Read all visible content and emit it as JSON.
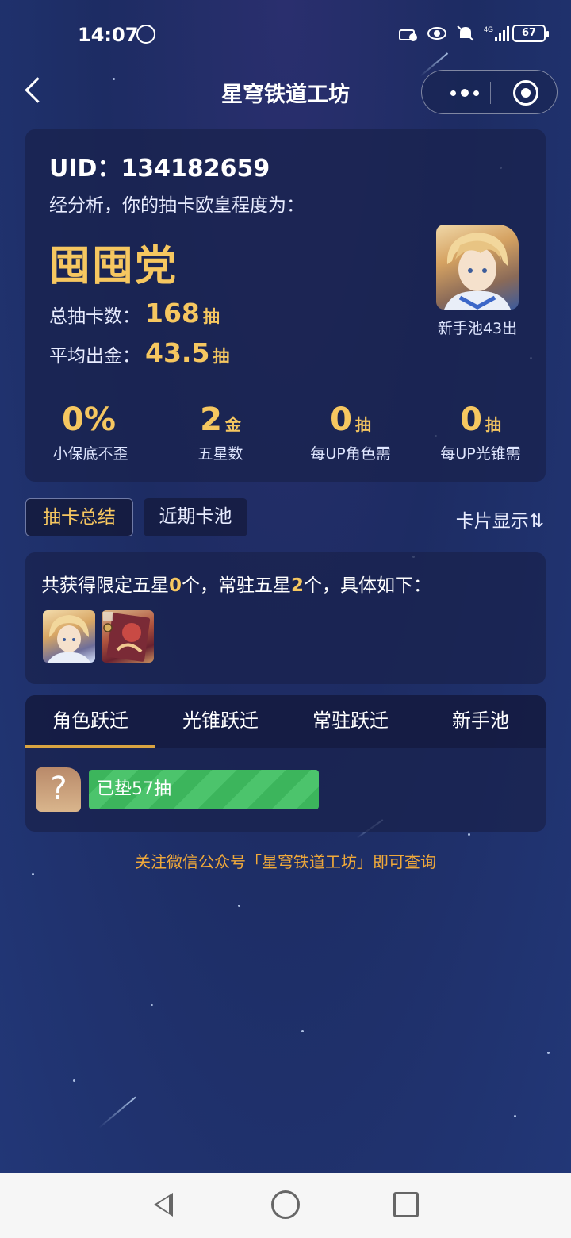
{
  "status_bar": {
    "time": "14:07",
    "battery": "67",
    "network": "4G"
  },
  "nav": {
    "title": "星穹铁道工坊"
  },
  "summary": {
    "uid_label": "UID：",
    "uid_value": "134182659",
    "analysis": "经分析，你的抽卡欧皇程度为：",
    "rank": "囤囤党",
    "total_label": "总抽卡数：",
    "total_value": "168",
    "total_unit": "抽",
    "avg_label": "平均出金：",
    "avg_value": "43.5",
    "avg_unit": "抽",
    "avatar_caption": "新手池43出",
    "stats": [
      {
        "value": "0%",
        "unit": "",
        "label": "小保底不歪"
      },
      {
        "value": "2",
        "unit": "金",
        "label": "五星数"
      },
      {
        "value": "0",
        "unit": "抽",
        "label": "每UP角色需"
      },
      {
        "value": "0",
        "unit": "抽",
        "label": "每UP光锥需"
      }
    ]
  },
  "view_tabs": {
    "summary": "抽卡总结",
    "recent": "近期卡池",
    "display_toggle": "卡片显示⇅"
  },
  "five_star": {
    "prefix": "共获得限定五星",
    "limited_count": "0",
    "middle": "个，常驻五星",
    "standard_count": "2",
    "suffix": "个，具体如下："
  },
  "pool_tabs": [
    "角色跃迁",
    "光锥跃迁",
    "常驻跃迁",
    "新手池"
  ],
  "pity": {
    "unknown_icon": "?",
    "bar_text": "已垫57抽",
    "fill_fraction": 0.57
  },
  "footer": {
    "follow_text": "关注微信公众号「星穹铁道工坊」即可查询"
  },
  "colors": {
    "gold": "#f6c760",
    "progress_green": "#3cb55c",
    "tab_underline": "#d9a441",
    "footer_orange": "#f0a93a"
  }
}
